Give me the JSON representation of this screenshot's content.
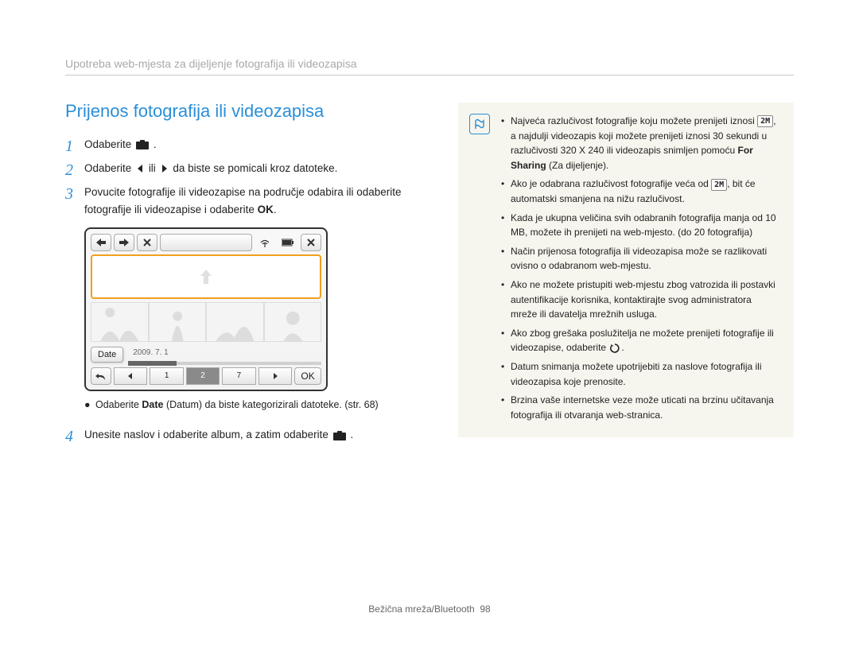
{
  "breadcrumb": "Upotreba web-mjesta za dijeljenje fotografija ili videozapisa",
  "section_title": "Prijenos fotografija ili videozapisa",
  "steps": {
    "s1": {
      "num": "1",
      "pre": "Odaberite ",
      "post": "."
    },
    "s2": {
      "num": "2",
      "pre": "Odaberite ",
      "mid": " ili ",
      "post": " da biste se pomicali kroz datoteke."
    },
    "s3": {
      "num": "3",
      "text_a": "Povucite fotografije ili videozapise na područje odabira ili odaberite fotografije ili videozapise i odaberite ",
      "ok": "OK",
      "text_b": "."
    },
    "s4": {
      "num": "4",
      "pre": "Unesite naslov i odaberite album, a zatim odaberite ",
      "post": "."
    }
  },
  "device": {
    "date_button": "Date",
    "date_value": "2009. 7. 1",
    "segs": [
      "1",
      "2",
      "7"
    ],
    "ok": "OK"
  },
  "sub_bullet": {
    "pre": "Odaberite ",
    "date_bold": "Date",
    "mid": " (Datum) da biste kategorizirali datoteke. (str. 68)"
  },
  "info": {
    "items": [
      {
        "pre": "Najveća razlučivost fotografije koju možete prenijeti iznosi ",
        "badge": "2M",
        "mid": ", a najdulji videozapis koji možete prenijeti iznosi 30 sekundi u razlučivosti 320 X 240 ili videozapis snimljen pomoću ",
        "bold": "For Sharing",
        "post": " (Za dijeljenje)."
      },
      {
        "pre": "Ako je odabrana razlučivost fotografije veća od ",
        "badge": "2M",
        "post": ", bit će automatski smanjena na nižu razlučivost."
      },
      {
        "text": "Kada je ukupna veličina svih odabranih fotografija manja od 10 MB, možete ih prenijeti na web-mjesto. (do 20 fotografija)"
      },
      {
        "text": "Način prijenosa fotografija ili videozapisa može se razlikovati ovisno o odabranom web-mjestu."
      },
      {
        "text": "Ako ne možete pristupiti web-mjestu zbog vatrozida ili postavki autentifikacije korisnika, kontaktirajte svog administratora mreže ili davatelja mrežnih usluga."
      },
      {
        "pre": "Ako zbog grešaka poslužitelja ne možete prenijeti fotografije ili videozapise, odaberite ",
        "icon": "refresh",
        "post": "."
      },
      {
        "text": "Datum snimanja možete upotrijebiti za naslove fotografija ili videozapisa koje prenosite."
      },
      {
        "text": "Brzina vaše internetske veze može uticati na brzinu učitavanja fotografija ili otvaranja web-stranica."
      }
    ]
  },
  "footer": {
    "section": "Bežična mreža/Bluetooth",
    "page": "98"
  }
}
